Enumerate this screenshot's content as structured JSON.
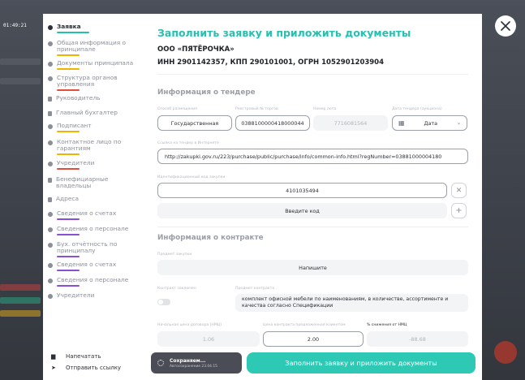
{
  "clock": "01:49:21",
  "sidebar": {
    "items": [
      {
        "label": "Заявка",
        "icon": "dot-icon",
        "active": true,
        "bar": "#26c0b0"
      },
      {
        "label": "Общая информация о принципале",
        "icon": "dot-icon",
        "bar": "#f0b400"
      },
      {
        "label": "Документы принципала",
        "icon": "dot-icon",
        "bar": "#f0b400"
      },
      {
        "label": "Структура органов управления",
        "icon": "dot-icon",
        "bar": "#e34d3b"
      },
      {
        "label": "Руководитель",
        "icon": "doc-icon"
      },
      {
        "label": "Главный бухгалтер",
        "icon": "doc-icon"
      },
      {
        "label": "Подписант",
        "icon": "dot-icon",
        "bar": "#f0b400"
      },
      {
        "label": "Контактное лицо по гарантиям",
        "icon": "dot-icon",
        "bar": "#f0b400"
      },
      {
        "label": "Учредители",
        "icon": "dot-icon",
        "bar": "#e34d3b"
      },
      {
        "label": "Бенефициарные владельцы",
        "icon": "doc-icon"
      },
      {
        "label": "Адреса",
        "icon": "doc-icon"
      },
      {
        "label": "Сведения о счетах",
        "icon": "dot-icon",
        "bar": "#8a4fd6"
      },
      {
        "label": "Сведения о персонале",
        "icon": "dot-icon",
        "bar": "#8a4fd6"
      },
      {
        "label": "Бух. отчётность по принципалу",
        "icon": "dot-icon",
        "bar": "#8a4fd6"
      },
      {
        "label": "Сведения о счетах",
        "icon": "dot-icon",
        "bar": "#8a4fd6"
      },
      {
        "label": "Сведения о персонале",
        "icon": "dot-icon",
        "bar": "#8a4fd6"
      },
      {
        "label": "Учредители",
        "icon": "dot-icon"
      }
    ],
    "print_label": "Напечатать",
    "send_label": "Отправить ссылку"
  },
  "modal": {
    "title": "Заполнить заявку и приложить документы",
    "org_name": "ООО «ПЯТЁРОЧКА»",
    "org_ids": "ИНН 2901142357, КПП 290101001, ОГРН 1052901203904",
    "tender": {
      "heading": "Информация о тендере",
      "method_label": "Способ размещения",
      "method_value": "Государственная",
      "registry_label": "Реестровый № торгов",
      "registry_value": "0388100000418000044",
      "lot_label": "Номер лота",
      "lot_value": "7716081564",
      "date_label": "Дата тендера (аукциона)",
      "date_value": "Дата",
      "link_label": "Ссылка на тендер в Интернете",
      "link_value": "http://zakupki.gov.ru/223/purchase/public/purchase/info/common-info.html?regNumber=03881000004180",
      "ikz_label": "Идентификационный код закупки",
      "ikz_value": "4101035494",
      "code_placeholder": "Введите код"
    },
    "contract": {
      "heading": "Информация о контракте",
      "subject_label": "Предмет закупки",
      "subject_value": "Напишите",
      "concluded_label": "Контракт заключен",
      "contract_subject_label": "Предмет контракта",
      "contract_subject_value": "комплект офисной мебели по наименованиям, в количестве, ассортименте и качества согласно Спецификации",
      "start_price_label": "Начальная цена договора (НМЦ)",
      "start_price_value": "1.06",
      "offer_price_label": "Цена контракта предложенная клиентом",
      "offer_price_value": "2.00",
      "reduction_label": "% снижения от НМЦ",
      "reduction_value": "-88.68"
    }
  },
  "footer": {
    "saving_title": "Сохраняем...",
    "saving_sub": "Автосохранение 23.04.15",
    "submit_label": "Заполнить заявку и приложить документы"
  }
}
